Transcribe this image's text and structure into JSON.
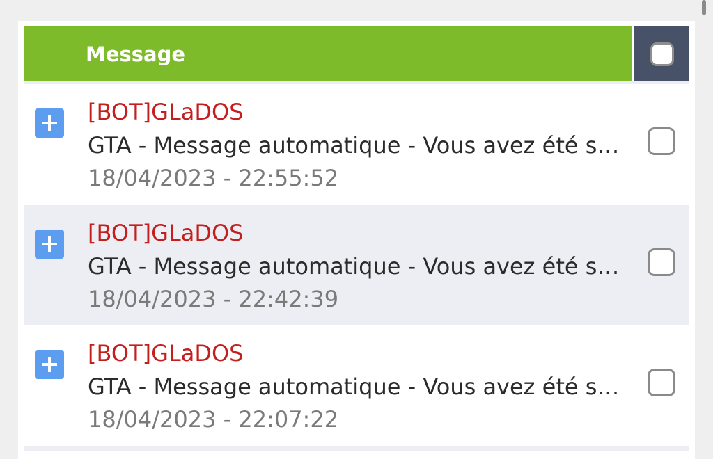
{
  "header": {
    "title": "Message"
  },
  "messages": [
    {
      "author": "[BOT]GLaDOS",
      "subject": "GTA - Message automatique - Vous avez été sanc…",
      "timestamp": "18/04/2023 - 22:55:52"
    },
    {
      "author": "[BOT]GLaDOS",
      "subject": "GTA - Message automatique - Vous avez été sanc…",
      "timestamp": "18/04/2023 - 22:42:39"
    },
    {
      "author": "[BOT]GLaDOS",
      "subject": "GTA - Message automatique - Vous avez été sanc…",
      "timestamp": "18/04/2023 - 22:07:22"
    }
  ],
  "colors": {
    "header_green": "#7dbb2a",
    "header_check_bg": "#475168",
    "author_red": "#c41e1e",
    "expand_blue": "#5d9df0",
    "alt_row": "#eceef3"
  },
  "icons": {
    "expand": "plus-icon"
  }
}
